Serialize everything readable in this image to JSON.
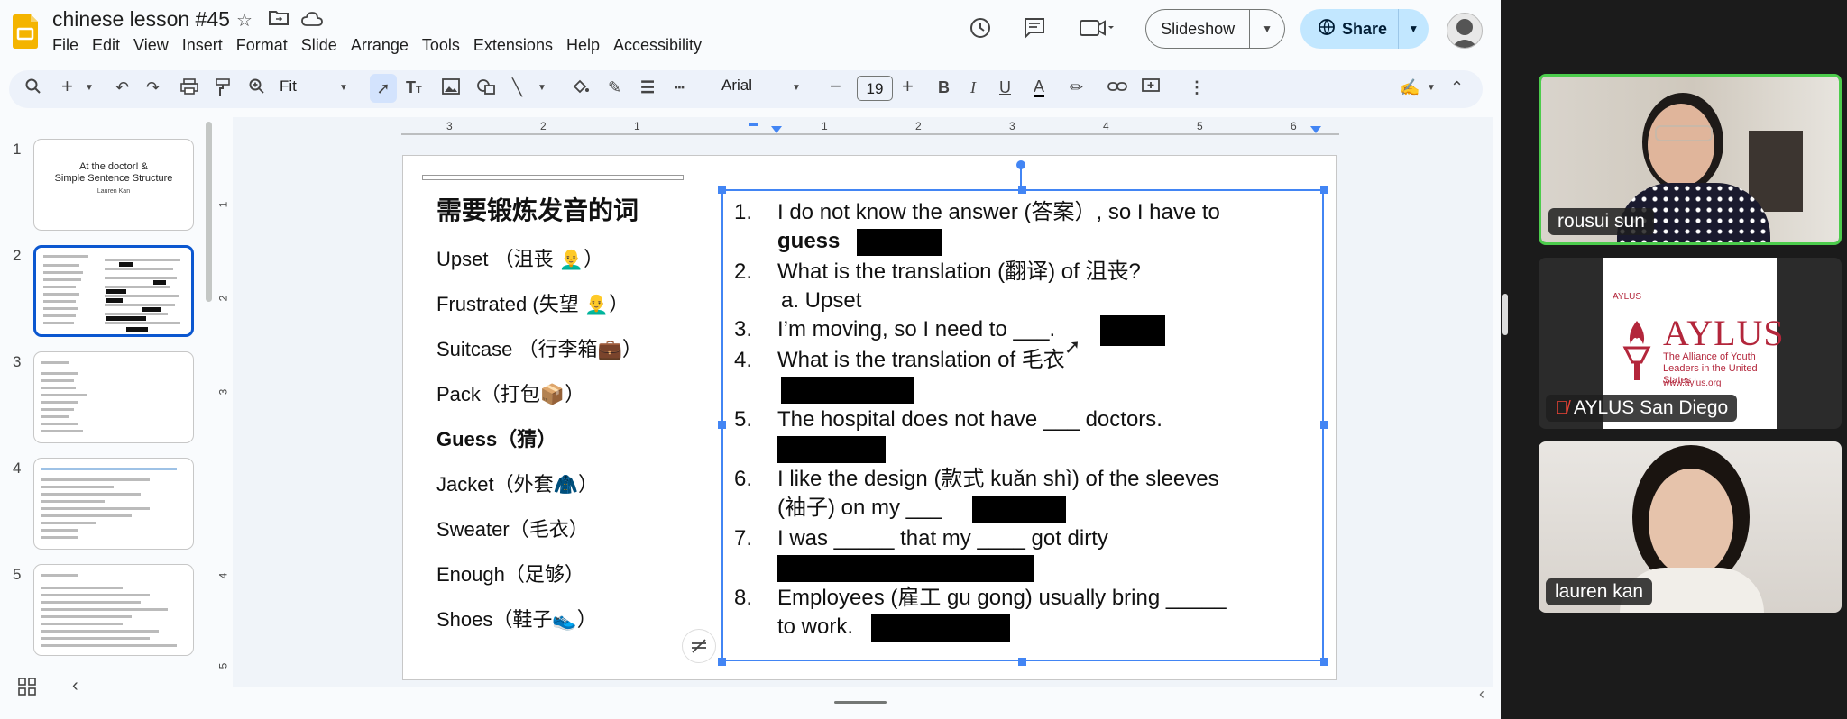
{
  "header": {
    "doc_title": "chinese lesson #45",
    "menu": [
      "File",
      "Edit",
      "View",
      "Insert",
      "Format",
      "Slide",
      "Arrange",
      "Tools",
      "Extensions",
      "Help",
      "Accessibility"
    ],
    "slideshow_label": "Slideshow",
    "share_label": "Share"
  },
  "toolbar": {
    "zoom": "Fit",
    "font": "Arial",
    "font_size": "19"
  },
  "ruler": {
    "h_labels": [
      "3",
      "2",
      "1",
      "1",
      "2",
      "3",
      "4",
      "5",
      "6"
    ],
    "v_labels": [
      "1",
      "2",
      "3",
      "4",
      "5"
    ]
  },
  "filmstrip": {
    "slides": [
      {
        "num": "1",
        "title": "At the doctor! &\nSimple Sentence Structure",
        "subtitle": "Lauren Kan"
      },
      {
        "num": "2"
      },
      {
        "num": "3"
      },
      {
        "num": "4"
      },
      {
        "num": "5"
      }
    ]
  },
  "slide": {
    "heading": "需要锻炼发音的词",
    "vocab": [
      {
        "text": "Upset （沮丧 👨‍🦲）",
        "bold": false
      },
      {
        "text": "Frustrated (失望 👨‍🦲）",
        "bold": false
      },
      {
        "text": "Suitcase （行李箱💼）",
        "bold": false
      },
      {
        "text": "Pack（打包📦）",
        "bold": false
      },
      {
        "text": "Guess（猜）",
        "bold": true
      },
      {
        "text": "Jacket（外套🧥）",
        "bold": false
      },
      {
        "text": "Sweater（毛衣）",
        "bold": false
      },
      {
        "text": "Enough（足够）",
        "bold": false
      },
      {
        "text": "Shoes（鞋子👟）",
        "bold": false
      }
    ],
    "questions": [
      {
        "num": "1.",
        "line1": "I do not know the answer (答案）, so I have to",
        "line2": "guess"
      },
      {
        "num": "2.",
        "line1": "What is the translation (翻译) of 沮丧?",
        "sub": "a.   Upset"
      },
      {
        "num": "3.",
        "line1": "I’m moving, so I need to ___."
      },
      {
        "num": "4.",
        "line1": "What is the translation of 毛衣"
      },
      {
        "num": "5.",
        "line1": "The hospital does not have ___ doctors."
      },
      {
        "num": "6.",
        "line1": "I like the design (款式 kuǎn shì) of the sleeves",
        "line2": "(袖子) on my ___"
      },
      {
        "num": "7.",
        "line1": "I was _____ that my ____ got dirty"
      },
      {
        "num": "8.",
        "line1": "Employees (雇工 gu gong) usually bring _____",
        "line2": "to work."
      }
    ]
  },
  "video": {
    "participants": [
      {
        "name": "rousui sun",
        "active": true
      },
      {
        "name": "AYLUS San Diego",
        "muted": true
      },
      {
        "name": "lauren kan"
      }
    ],
    "aylus_logo_text": "AYLUS",
    "aylus_tagline": "The Alliance of Youth Leaders in the United States",
    "aylus_url": "www.aylus.org",
    "aylus_corner": "AYLUS"
  },
  "colors": {
    "accent": "#0b57d0",
    "share_bg": "#c2e7ff",
    "active_speaker": "#4ccc4c",
    "aylus_red": "#b3263b"
  }
}
